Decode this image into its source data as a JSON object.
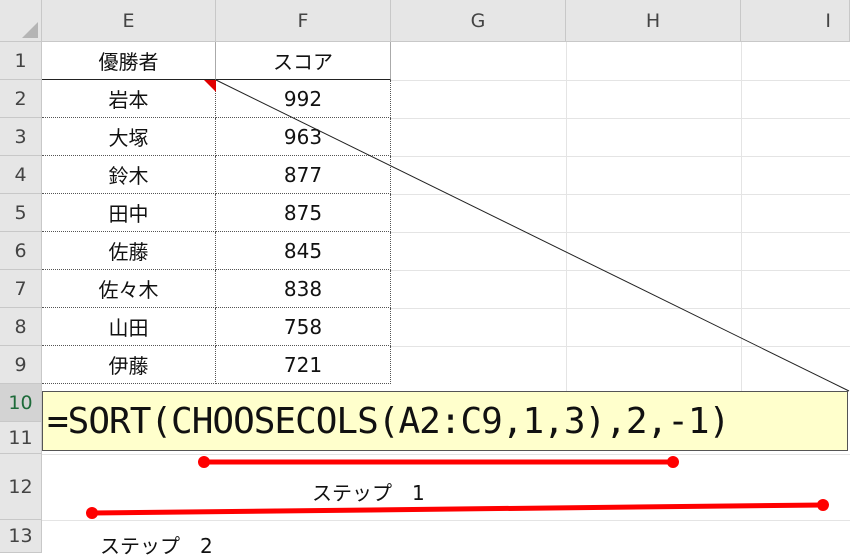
{
  "columns": [
    "E",
    "F",
    "G",
    "H",
    "I"
  ],
  "rows": [
    "1",
    "2",
    "3",
    "4",
    "5",
    "6",
    "7",
    "8",
    "9",
    "10",
    "11",
    "12",
    "13"
  ],
  "table": {
    "headers": [
      "優勝者",
      "スコア"
    ],
    "data": [
      [
        "岩本",
        "992"
      ],
      [
        "大塚",
        "963"
      ],
      [
        "鈴木",
        "877"
      ],
      [
        "田中",
        "875"
      ],
      [
        "佐藤",
        "845"
      ],
      [
        "佐々木",
        "838"
      ],
      [
        "山田",
        "758"
      ],
      [
        "伊藤",
        "721"
      ]
    ]
  },
  "formula": "=SORT(CHOOSECOLS(A2:C9,1,3),2,-1)",
  "annotations": {
    "step1": "ステップ　1",
    "step2": "ステップ　2"
  },
  "colors": {
    "header_bg": "#e6e6e6",
    "formula_bg": "#ffffcc",
    "marker": "#ff0000"
  }
}
